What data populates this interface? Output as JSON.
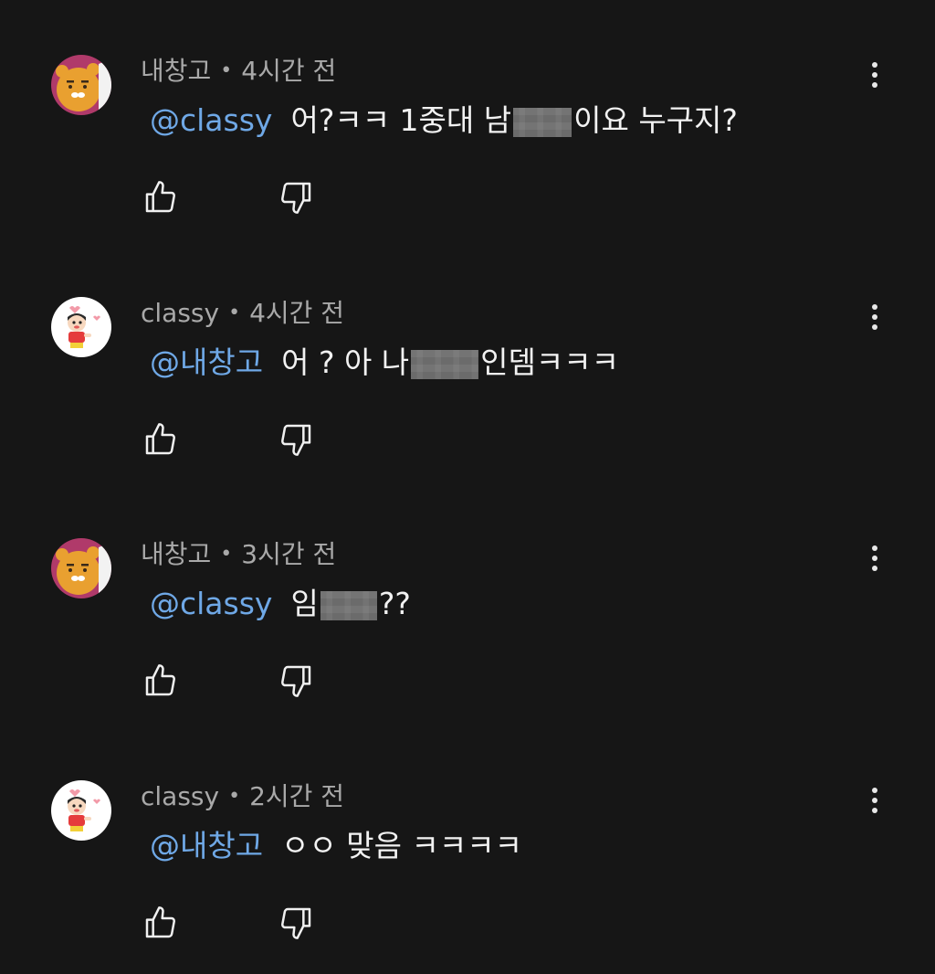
{
  "comments": [
    {
      "author": "내창고",
      "avatar_icon": "ryan-avatar-icon",
      "time": "4시간 전",
      "mention": "@classy",
      "text_before": "어?ㅋㅋ 1중대 남",
      "text_after": "이요 누구지?"
    },
    {
      "author": "classy",
      "avatar_icon": "shinchan-avatar-icon",
      "time": "4시간 전",
      "mention": "@내창고",
      "text_before": "어 ? 아 나",
      "text_after": "인뎀ㅋㅋㅋ"
    },
    {
      "author": "내창고",
      "avatar_icon": "ryan-avatar-icon",
      "time": "3시간 전",
      "mention": "@classy",
      "text_before": "임",
      "text_after": "??"
    },
    {
      "author": "classy",
      "avatar_icon": "shinchan-avatar-icon",
      "time": "2시간 전",
      "mention": "@내창고",
      "text_before": "ㅇㅇ 맞음 ㅋㅋㅋㅋ",
      "text_after": ""
    }
  ],
  "icons": {
    "like": "thumbs-up-icon",
    "dislike": "thumbs-down-icon",
    "more": "more-vertical-icon"
  },
  "colors": {
    "background": "#161616",
    "mention": "#6fa8e6",
    "meta": "#a9a9a9",
    "text": "#f2f2f2"
  }
}
